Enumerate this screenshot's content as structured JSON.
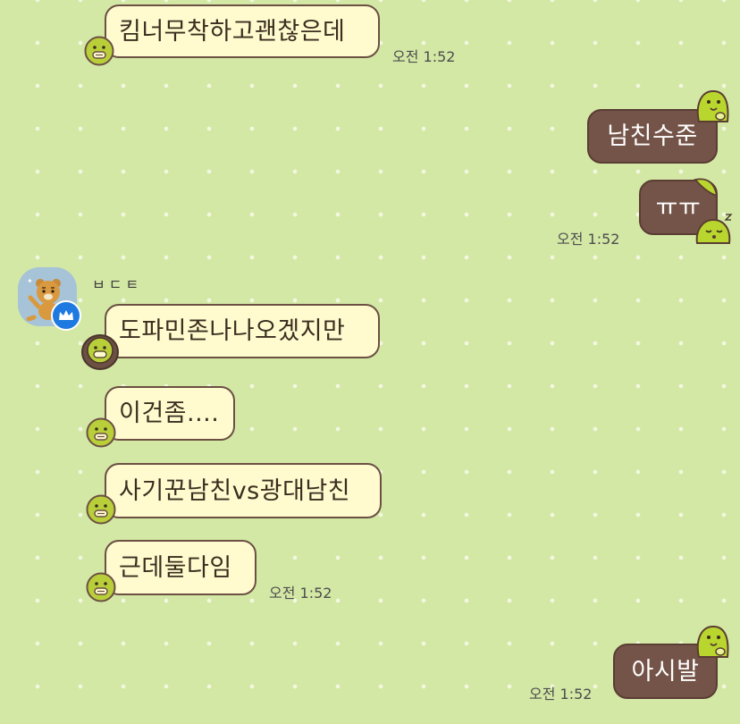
{
  "messages": [
    {
      "text": "킴너무착하고괜찮은데",
      "time": "오전 1:52"
    },
    {
      "text": "남친수준"
    },
    {
      "text": "ㅠㅠ",
      "time": "오전 1:52"
    },
    {
      "sender": "ㅂㄷㅌ"
    },
    {
      "text": "도파민존나나오겠지만"
    },
    {
      "text": "이건좀...."
    },
    {
      "text": "사기꾼남친vs광대남친"
    },
    {
      "text": "근데둘다임",
      "time": "오전 1:52"
    },
    {
      "text": "아시발",
      "time": "오전 1:52"
    }
  ],
  "colors": {
    "background": "#d4e8a6",
    "incoming_bubble": "#fffbcf",
    "outgoing_bubble": "#745448",
    "bubble_border": "#6b5043",
    "avatar_bg": "#a6c3d8",
    "crown_badge": "#1e7ae0"
  },
  "icons": {
    "incoming_bubble_tail": "yellow-chick-icon",
    "outgoing_bubble_tail": "green-slime-icon",
    "sleepy_tail": "sleepy-slime-icon",
    "avatar": "bear-character-avatar",
    "badge": "crown-icon"
  }
}
